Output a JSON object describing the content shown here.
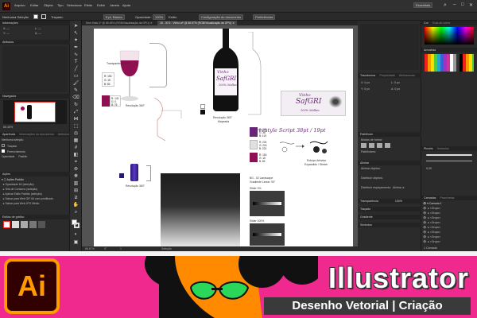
{
  "topbar": {
    "app_abbrev": "Ai",
    "workspace": "Essentials",
    "menu": [
      "Arquivo",
      "Editar",
      "Objeto",
      "Tipo",
      "Selecionar",
      "Efeito",
      "Exibir",
      "Janela",
      "Ajuda"
    ]
  },
  "menubar": {
    "no_selection": "Nenhuma Seleção",
    "stroke_label": "Traçado:",
    "brush": "5 pt. Básico",
    "opacity_label": "Opacidade:",
    "opacity_value": "100%",
    "style_label": "Estilo:",
    "doc_setup": "Configuração do documento",
    "prefs": "Preferências"
  },
  "left_panel": {
    "info_title": "Informações",
    "color_title": "Cor",
    "attrs_title": "Atributos",
    "navigator_title": "Navegador",
    "zoom_value": "65.45%",
    "appearance_title": "Aparência",
    "appearance_tab2": "Informações do documento",
    "appearance_tab3": "Atributos",
    "no_selection": "Nenhuma seleção",
    "stroke": "Traçado",
    "fill": "Preenchimento",
    "opacity": "Opacidade",
    "opacity_value": "Padrão",
    "actions_title": "Ações",
    "actions": [
      "Ações Padrão",
      "Opacidade 60 (seleção)",
      "Tela de Contorno (seleção)",
      "Aplicar Estilo Padrão (seleção)",
      "Salvar para Web GIF 64 com pontilhado",
      "Salvar para Web JPG Médio"
    ],
    "graphic_styles_title": "Estilos de gráfico"
  },
  "doc_tabs": [
    {
      "label": "Sem título-1* @ 65.45% (RGB/Visualização da GPU)",
      "active": false
    },
    {
      "label": "18 - 30 5 - Vinho.ai* @ 66.67% (RGB/Visualização da GPU)",
      "active": true
    }
  ],
  "artboard": {
    "glass_caption": "Transparência 20%",
    "glass_rgb": [
      "R: 153",
      "G: 15",
      "B: 83"
    ],
    "glass_cmyk": [
      "R: 142",
      "G: 0",
      "B: 76"
    ],
    "revolve_caption_1": "Revolução 360°",
    "bottle_caption": "Revolução 360°",
    "bottle_sub": "Mapeada",
    "bottle_label_1": "Vinho",
    "bottle_label_2": "SafGRI",
    "bottle_label_3": "100% Malbec",
    "logo_text_1": "Vinho",
    "logo_text_2": "SafGRI",
    "logo_text_3": "100% Malbec",
    "script_title": "Freestyle Script 38pt / 19pt",
    "purple_rgb": [
      "R: 105",
      "G: 36",
      "B: 119"
    ],
    "gray_rgb": [
      "R: 224",
      "G: 224",
      "B: 224"
    ],
    "red_rgb": [
      "R: 153",
      "G: 15",
      "B: 83"
    ],
    "sketch_caption_1": "Esboço Artístico",
    "sketch_caption_2": "Expandido / Sketch",
    "cork_caption": "Revolução 360°",
    "gradient_caption_1": "BG - 02 Landscape",
    "gradient_caption_2": "Gradiente Linear: 90°",
    "slider_caption_1": "Slider 0%",
    "slider_caption_2": "Slider 100%"
  },
  "status_bar": {
    "zoom": "66.67%",
    "angle": "0°",
    "page": "1",
    "mode": "Seleção"
  },
  "mid_panel": {
    "transform_title": "Transformar",
    "transform_tabs": [
      "Propriedade",
      "Alinhamento"
    ],
    "x_label": "X:",
    "y_label": "Y:",
    "w_label": "L:",
    "h_label": "A:",
    "x": "0 px",
    "y": "0 px",
    "w": "0 px",
    "h": "0 px",
    "pathfinder_title": "Pathfinder",
    "shape_modes": "Modos de forma:",
    "pathfinders": "Pathfinders:",
    "align_title": "Alinhar",
    "align_objects": "Alinhar objetos:",
    "distribute_objects": "Distribuir objetos:",
    "distribute_spacing": "Distribuir espaçamento:",
    "align_to": "Alinhar a:",
    "transparency_title": "Transparência",
    "transparency_value": "100%",
    "stroke_title": "Traçado",
    "gradient_title": "Gradiente",
    "symbols_title": "Símbolos"
  },
  "right_panel": {
    "color_title": "Cor",
    "color_guide": "Guia de cores",
    "swatches_title": "Amostras",
    "brushes_title": "Pincéis",
    "symbols_tab": "Símbolos",
    "brush_value": "5,00",
    "layers_title": "Camadas",
    "artboards_title": "Pranchetas",
    "layers": [
      "Camada 1",
      "<Grupo>",
      "<Grupo>",
      "<Grupo>",
      "<Grupo>",
      "<Grupo>",
      "<Grupo>",
      "<Grupo>",
      "<Grupo>"
    ],
    "layer_count": "1 Camada"
  },
  "banner": {
    "logo": "Ai",
    "title": "Illustrator",
    "subtitle": "Desenho Vetorial | Criação"
  },
  "colors": {
    "wine": "#8f0f52",
    "purple": "#692477",
    "gray": "#e0e0e0",
    "banner_pink": "#f0298e",
    "ai_orange": "#ff9a00",
    "ai_dark": "#310000"
  }
}
